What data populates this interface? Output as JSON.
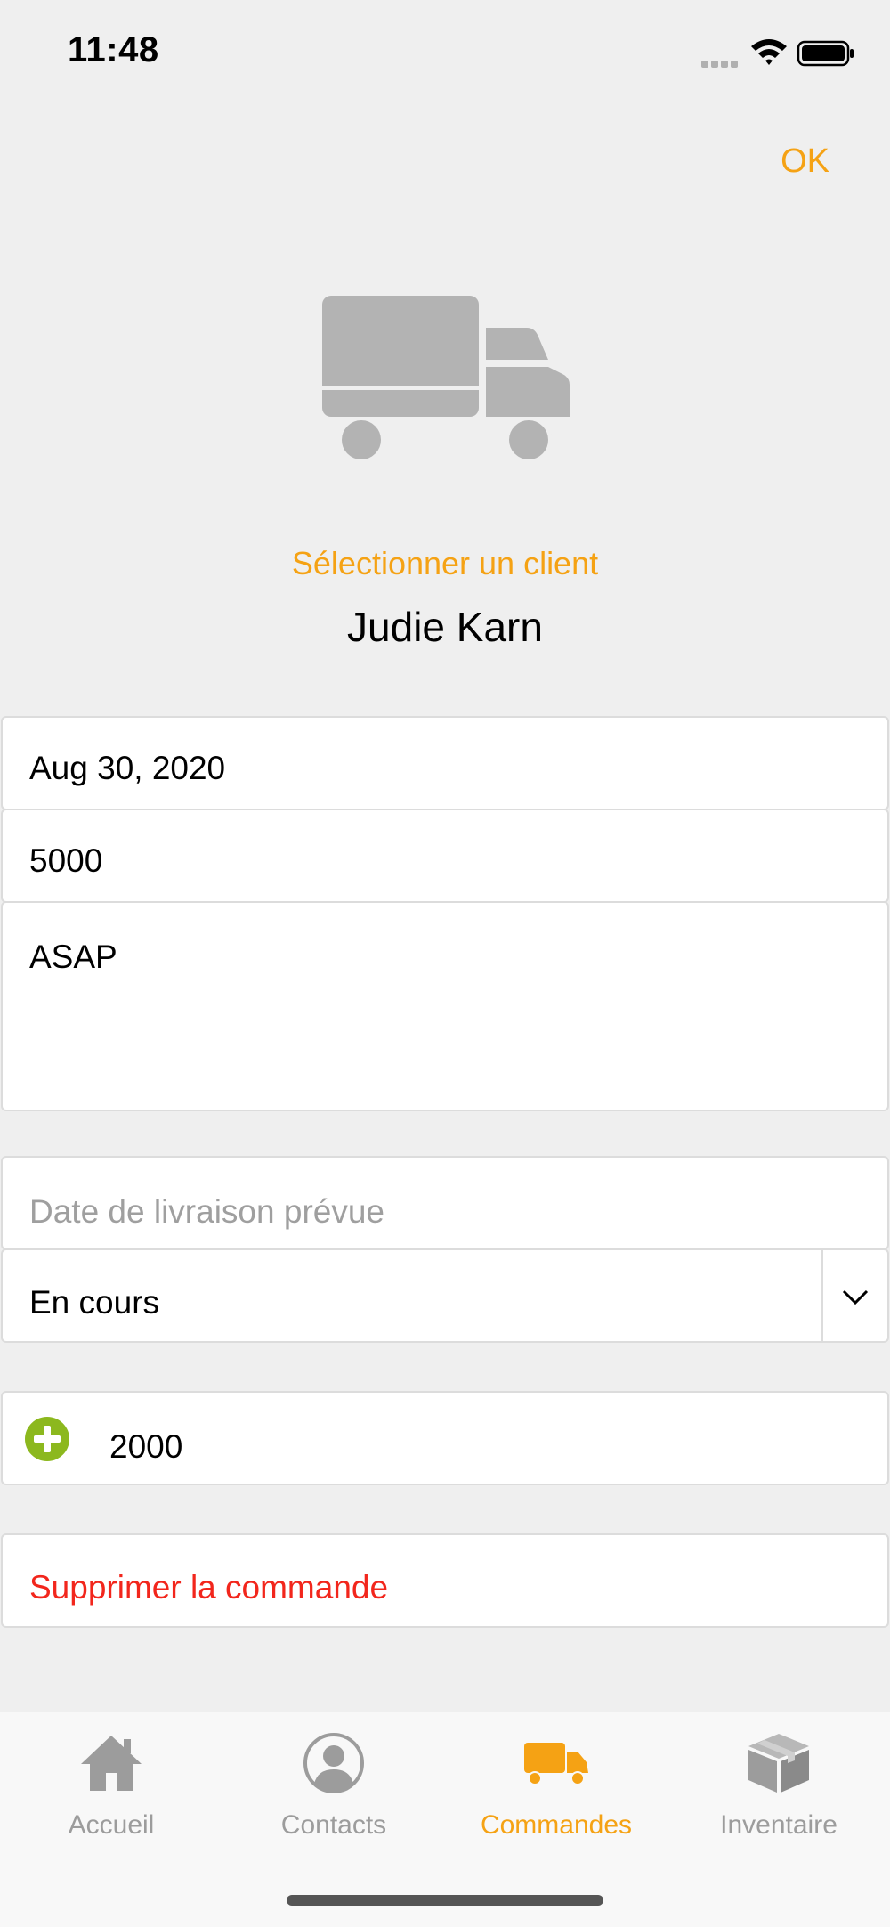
{
  "status_bar": {
    "time": "11:48"
  },
  "header": {
    "ok_label": "OK"
  },
  "client": {
    "select_label": "Sélectionner un client",
    "name": "Judie Karn"
  },
  "form": {
    "date": "Aug 30, 2020",
    "amount": "5000",
    "notes": "ASAP",
    "delivery_placeholder": "Date de livraison prévue",
    "status": "En cours",
    "item_value": "2000",
    "delete_label": "Supprimer la commande"
  },
  "colors": {
    "accent": "#f5a214",
    "danger": "#f2261c",
    "add": "#8cb81e"
  },
  "tabs": [
    {
      "label": "Accueil",
      "icon": "home-icon",
      "active": false
    },
    {
      "label": "Contacts",
      "icon": "person-icon",
      "active": false
    },
    {
      "label": "Commandes",
      "icon": "truck-icon",
      "active": true
    },
    {
      "label": "Inventaire",
      "icon": "box-icon",
      "active": false
    }
  ]
}
